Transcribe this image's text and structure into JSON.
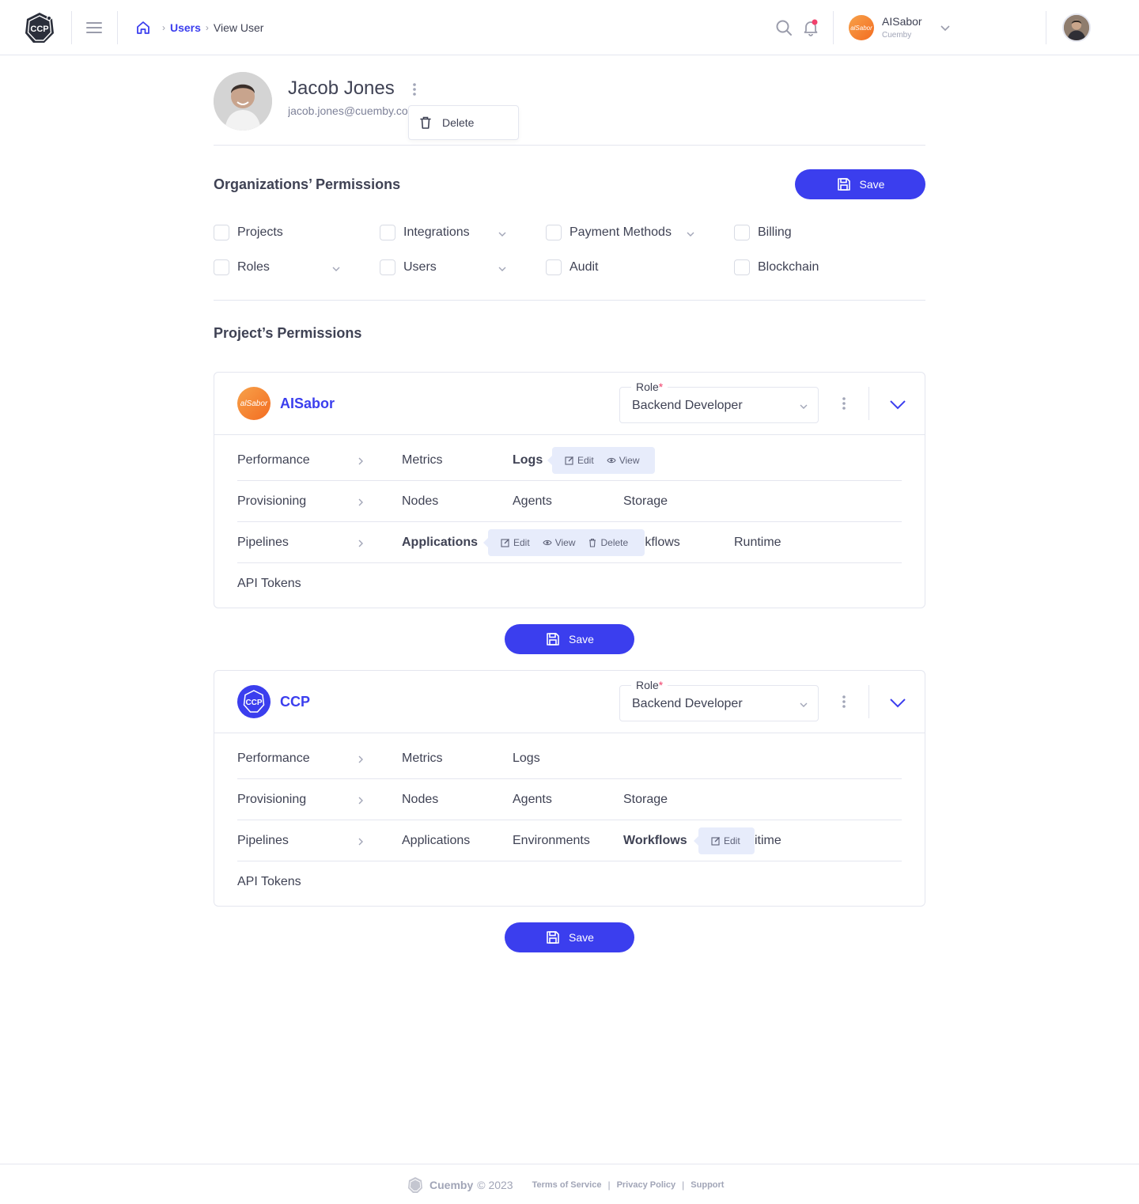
{
  "header": {
    "logo_text": "CCP",
    "breadcrumb": {
      "link": "Users",
      "current": "View User"
    },
    "org": {
      "name": "AISabor",
      "sub": "Cuemby",
      "avatar_text": "alSabor"
    }
  },
  "profile": {
    "name": "Jacob Jones",
    "email": "jacob.jones@cuemby.com",
    "menu": {
      "delete_label": "Delete"
    }
  },
  "org_permissions": {
    "title": "Organizations’ Permissions",
    "save_label": "Save",
    "items": [
      "Projects",
      "Integrations",
      "Payment Methods",
      "Billing",
      "Roles",
      "Users",
      "Audit",
      "Blockchain"
    ]
  },
  "project_permissions": {
    "title": "Project’s Permissions",
    "save_label": "Save",
    "projects": [
      {
        "name": "AISabor",
        "logo_text": "alSabor",
        "role_label": "Role",
        "role_value": "Backend Developer",
        "rows": [
          {
            "group": "Performance",
            "items": [
              "Metrics",
              "Logs"
            ]
          },
          {
            "group": "Provisioning",
            "items": [
              "Nodes",
              "Agents",
              "Storage"
            ]
          },
          {
            "group": "Pipelines",
            "items": [
              "Applications",
              "rkflows",
              "Runtime"
            ]
          },
          {
            "group": "API Tokens",
            "items": []
          }
        ],
        "popovers": [
          {
            "target": "Logs",
            "actions": [
              "Edit",
              "View"
            ]
          },
          {
            "target": "Applications",
            "actions": [
              "Edit",
              "View",
              "Delete"
            ]
          }
        ]
      },
      {
        "name": "CCP",
        "logo_text": "CCP",
        "role_label": "Role",
        "role_value": "Backend Developer",
        "rows": [
          {
            "group": "Performance",
            "items": [
              "Metrics",
              "Logs"
            ]
          },
          {
            "group": "Provisioning",
            "items": [
              "Nodes",
              "Agents",
              "Storage"
            ]
          },
          {
            "group": "Pipelines",
            "items": [
              "Applications",
              "Environments",
              "Workflows",
              "itime"
            ]
          },
          {
            "group": "API Tokens",
            "items": []
          }
        ],
        "popovers": [
          {
            "target": "Workflows",
            "actions": [
              "Edit"
            ]
          }
        ]
      }
    ]
  },
  "footer": {
    "brand": "Cuemby",
    "copyright": "© 2023",
    "links": [
      "Terms of Service",
      "Privacy Policy",
      "Support"
    ]
  },
  "colors": {
    "primary": "#3b3eee",
    "border": "#e4e6ef",
    "text": "#3f4254",
    "muted": "#a1a5b7",
    "danger": "#f1416c",
    "popover": "#e7ecfb"
  }
}
